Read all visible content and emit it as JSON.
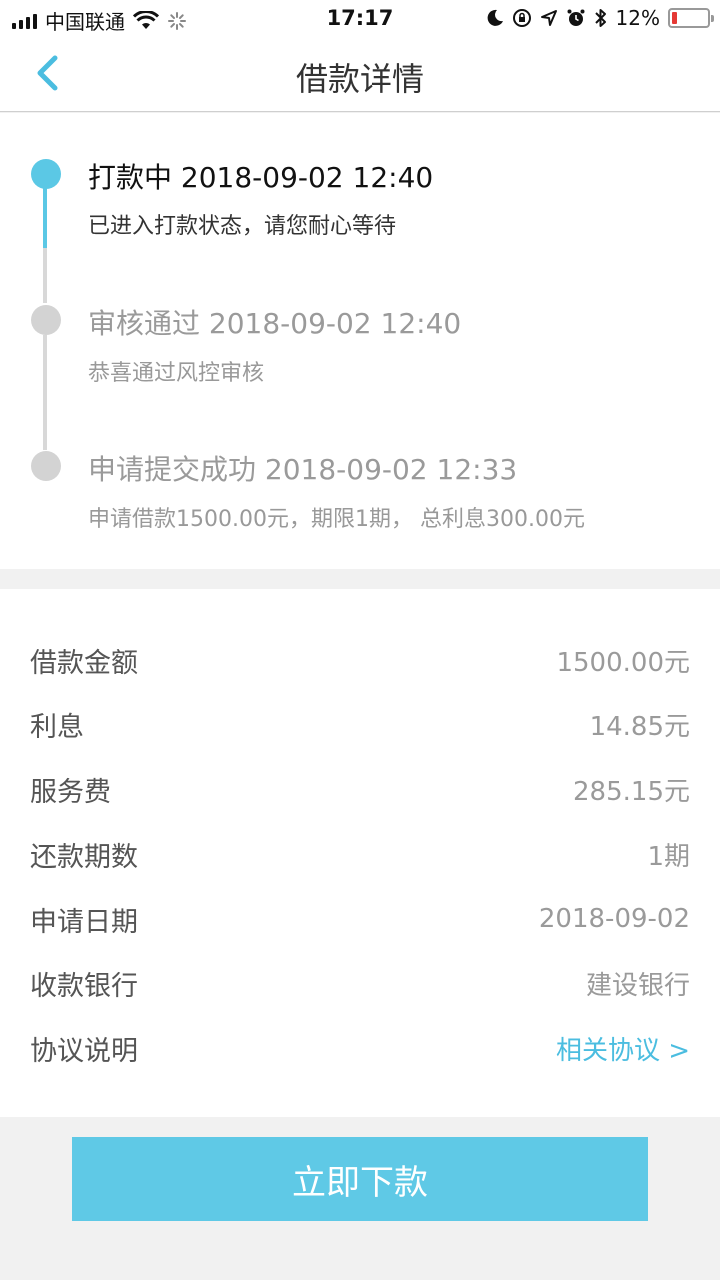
{
  "status_bar": {
    "carrier": "中国联通",
    "time": "17:17",
    "battery": "12%"
  },
  "nav": {
    "title": "借款详情"
  },
  "timeline": [
    {
      "title": "打款中 2018-09-02 12:40",
      "desc": "已进入打款状态，请您耐心等待",
      "active": true
    },
    {
      "title": "审核通过 2018-09-02 12:40",
      "desc": "恭喜通过风控审核",
      "active": false
    },
    {
      "title": "申请提交成功 2018-09-02 12:33",
      "desc": "申请借款1500.00元，期限1期， 总利息300.00元",
      "active": false
    }
  ],
  "details": [
    {
      "label": "借款金额",
      "value": "1500.00元"
    },
    {
      "label": "利息",
      "value": "14.85元"
    },
    {
      "label": "服务费",
      "value": "285.15元"
    },
    {
      "label": "还款期数",
      "value": "1期"
    },
    {
      "label": "申请日期",
      "value": "2018-09-02"
    },
    {
      "label": "收款银行",
      "value": "建设银行"
    },
    {
      "label": "协议说明",
      "value": "相关协议 >"
    }
  ],
  "action": {
    "label": "立即下款"
  },
  "colors": {
    "accent": "#5fc9e6",
    "link": "#4bbde0",
    "inactive_dot": "#d3d3d3"
  }
}
